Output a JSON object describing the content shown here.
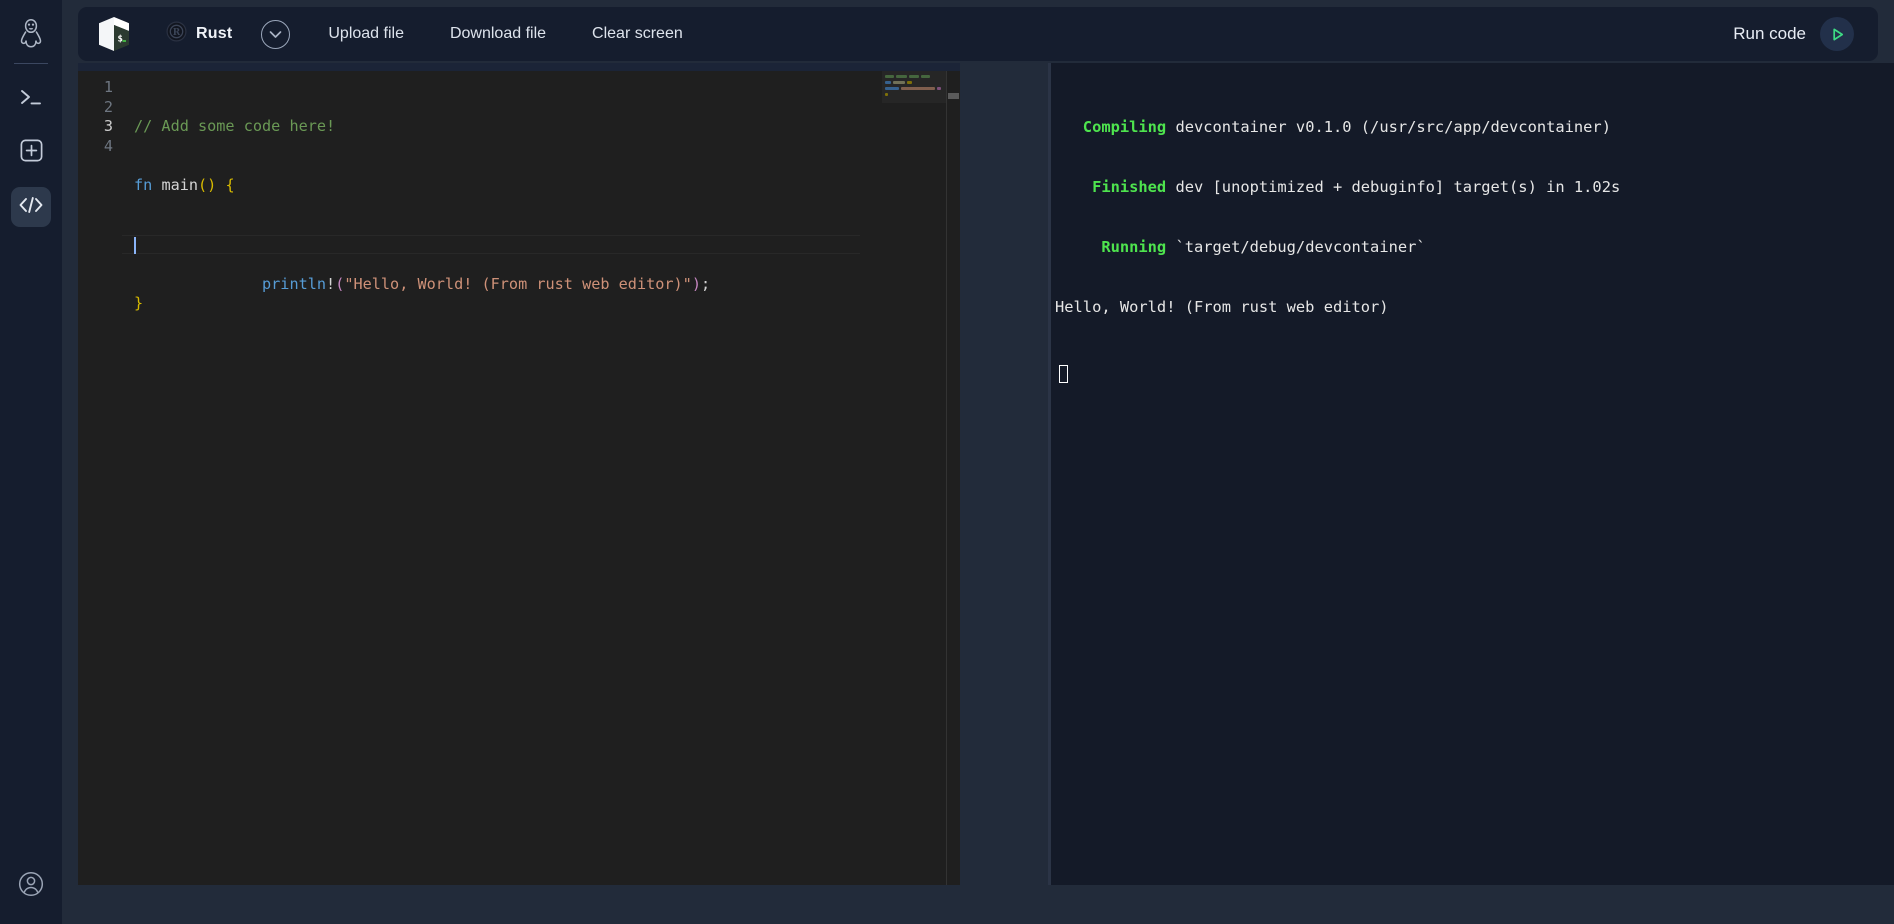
{
  "sidebar": {
    "logo_icon": "tux-penguin-logo",
    "items": [
      {
        "icon": "terminal-prompt-icon",
        "name": "terminal",
        "active": false
      },
      {
        "icon": "plus-box-icon",
        "name": "new-session",
        "active": false
      },
      {
        "icon": "code-brackets-icon",
        "name": "code-editor",
        "active": true
      }
    ],
    "account_icon": "user-avatar-icon"
  },
  "toolbar": {
    "app_logo_icon": "devcontainer-cube-icon",
    "language_icon": "rust-gear-icon",
    "language": "Rust",
    "language_dropdown_icon": "chevron-down-icon",
    "menu": [
      {
        "label": "Upload file",
        "name": "upload-file"
      },
      {
        "label": "Download file",
        "name": "download-file"
      },
      {
        "label": "Clear screen",
        "name": "clear-screen"
      }
    ],
    "run_label": "Run code",
    "run_icon": "play-triangle-icon",
    "run_accent": "#3ddc84"
  },
  "editor": {
    "line_numbers": [
      "1",
      "2",
      "3",
      "4"
    ],
    "active_line": 3,
    "lines": [
      {
        "tokens": [
          {
            "t": "// Add some code here!",
            "c": "c-comment"
          }
        ]
      },
      {
        "tokens": [
          {
            "t": "fn",
            "c": "c-kw"
          },
          {
            "t": " ",
            "c": "c-white"
          },
          {
            "t": "main",
            "c": "c-id"
          },
          {
            "t": "()",
            "c": "c-paren-y"
          },
          {
            "t": " ",
            "c": "c-white"
          },
          {
            "t": "{",
            "c": "c-brace"
          }
        ]
      },
      {
        "tokens": [
          {
            "t": "    ",
            "c": "c-white"
          },
          {
            "t": "println",
            "c": "c-kw"
          },
          {
            "t": "!",
            "c": "c-white"
          },
          {
            "t": "(",
            "c": "c-punc"
          },
          {
            "t": "\"Hello, World! (From rust web editor)\"",
            "c": "c-str"
          },
          {
            "t": ")",
            "c": "c-punc"
          },
          {
            "t": ";",
            "c": "c-white"
          }
        ]
      },
      {
        "tokens": [
          {
            "t": "}",
            "c": "c-brace"
          }
        ]
      }
    ]
  },
  "terminal": {
    "lines": [
      {
        "prefix": "   Compiling",
        "rest": " devcontainer v0.1.0 (/usr/src/app/devcontainer)"
      },
      {
        "prefix": "    Finished",
        "rest": " dev [unoptimized + debuginfo] target(s) in 1.02s"
      },
      {
        "prefix": "     Running",
        "rest": " `target/debug/devcontainer`"
      },
      {
        "prefix": "",
        "rest": "Hello, World! (From rust web editor)"
      }
    ],
    "cursor": "block-cursor"
  }
}
